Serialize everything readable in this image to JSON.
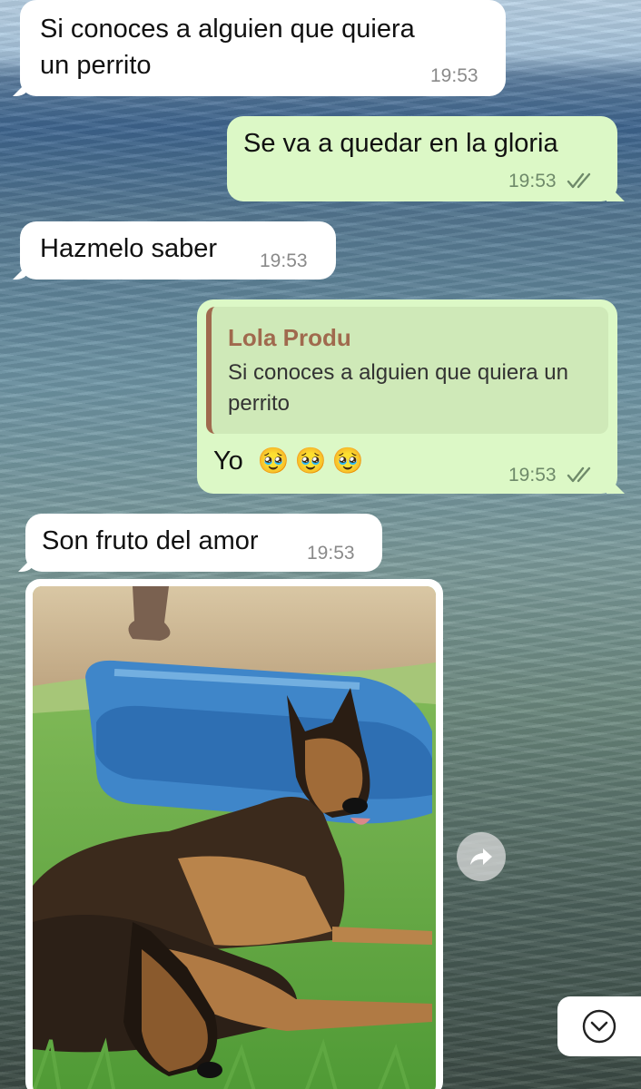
{
  "messages": [
    {
      "id": "m1",
      "direction": "incoming",
      "text": "Si conoces a alguien que quiera un perrito",
      "time": "19:53"
    },
    {
      "id": "m2",
      "direction": "outgoing",
      "text": "Se va a quedar en la gloria",
      "time": "19:53",
      "status": "read"
    },
    {
      "id": "m3",
      "direction": "incoming",
      "text": "Hazmelo saber",
      "time": "19:53"
    },
    {
      "id": "m4",
      "direction": "outgoing",
      "reply": {
        "author": "Lola Produ",
        "text": "Si conoces a alguien que quiera un perrito"
      },
      "text": "Yo",
      "emojis": "🥹🥹🥹",
      "time": "19:53",
      "status": "read"
    },
    {
      "id": "m5",
      "direction": "incoming",
      "text": "Son fruto del amor",
      "time": "19:53"
    },
    {
      "id": "m6",
      "direction": "incoming",
      "type": "photo",
      "photo_icon": "german-shepherd-dogs-photo"
    }
  ],
  "icons": {
    "forward": "forward-arrow-icon",
    "scroll": "chevron-down-icon",
    "ticks": "double-check-icon"
  },
  "colors": {
    "incoming": "#ffffff",
    "outgoing": "#dcf8c6",
    "quote_accent": "#a06a4e"
  }
}
